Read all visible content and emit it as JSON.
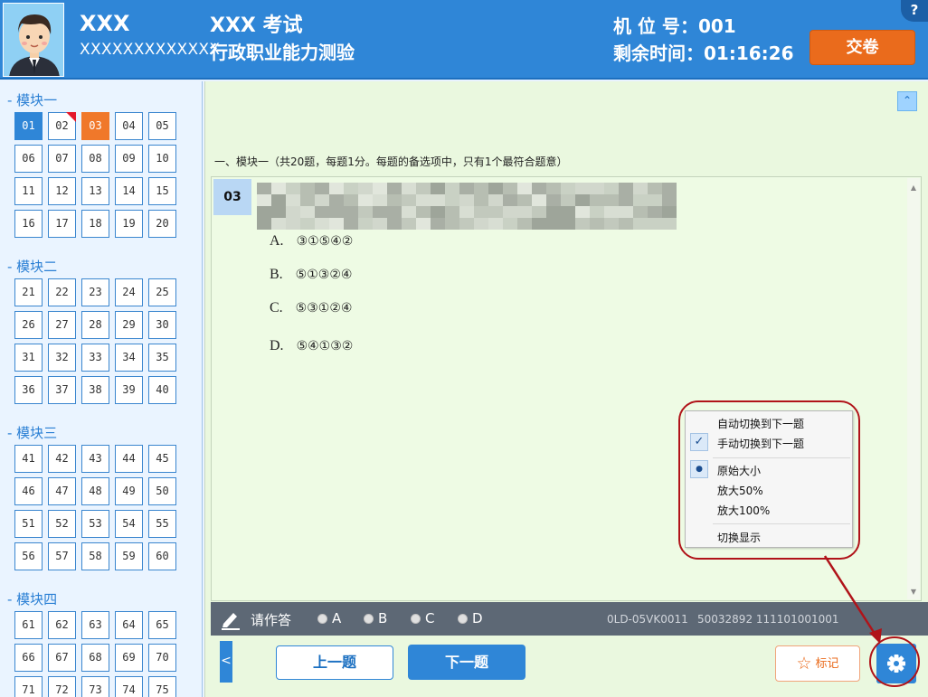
{
  "header": {
    "candidate_name": "XXX",
    "candidate_id": "XXXXXXXXXXXXX",
    "exam_title": "XXX 考试",
    "exam_subject": "行政职业能力测验",
    "seat_label": "机  位  号",
    "seat_value": "001",
    "time_label": "剩余时间",
    "time_value": "01:16:26",
    "submit_label": "交卷",
    "help_label": "?"
  },
  "sidebar": {
    "modules": [
      {
        "title": "- 模块一",
        "questions": [
          "01",
          "02",
          "03",
          "04",
          "05",
          "06",
          "07",
          "08",
          "09",
          "10",
          "11",
          "12",
          "13",
          "14",
          "15",
          "16",
          "17",
          "18",
          "19",
          "20"
        ]
      },
      {
        "title": "- 模块二",
        "questions": [
          "21",
          "22",
          "23",
          "24",
          "25",
          "26",
          "27",
          "28",
          "29",
          "30",
          "31",
          "32",
          "33",
          "34",
          "35",
          "36",
          "37",
          "38",
          "39",
          "40"
        ]
      },
      {
        "title": "- 模块三",
        "questions": [
          "41",
          "42",
          "43",
          "44",
          "45",
          "46",
          "47",
          "48",
          "49",
          "50",
          "51",
          "52",
          "53",
          "54",
          "55",
          "56",
          "57",
          "58",
          "59",
          "60"
        ]
      },
      {
        "title": "- 模块四",
        "questions": [
          "61",
          "62",
          "63",
          "64",
          "65",
          "66",
          "67",
          "68",
          "69",
          "70",
          "71",
          "72",
          "73",
          "74",
          "75"
        ]
      }
    ],
    "current": "01",
    "marked": [
      "02"
    ],
    "answered": [
      "03"
    ]
  },
  "main": {
    "section_header": "一、模块一（共20题，每题1分。每题的备选项中，只有1个最符合题意）",
    "question_number": "03",
    "options": [
      {
        "letter": "A.",
        "text": "③①⑤④②"
      },
      {
        "letter": "B.",
        "text": "⑤①③②④"
      },
      {
        "letter": "C.",
        "text": "⑤③①②④"
      },
      {
        "letter": "D.",
        "text": "⑤④①③②"
      }
    ]
  },
  "popup": {
    "items": [
      {
        "label": "自动切换到下一题",
        "check": ""
      },
      {
        "label": "手动切换到下一题",
        "check": "✓"
      },
      {
        "label": "原始大小",
        "check": "●"
      },
      {
        "label": "放大50%",
        "check": ""
      },
      {
        "label": "放大100%",
        "check": ""
      },
      {
        "label": "切换显示",
        "check": ""
      }
    ]
  },
  "answer_bar": {
    "label": "请作答",
    "choices": [
      "A",
      "B",
      "C",
      "D"
    ],
    "device_code": "0LD-05VK0011",
    "device_serial": "50032892 111101001001"
  },
  "nav": {
    "prev_label": "上一题",
    "next_label": "下一题",
    "mark_label": "标记",
    "prev_arrow": "<"
  },
  "colors": {
    "header_blue": "#2f86d7",
    "submit_orange": "#ea6b1c",
    "marked_red": "#e4172a",
    "content_green": "#eaf8df"
  }
}
